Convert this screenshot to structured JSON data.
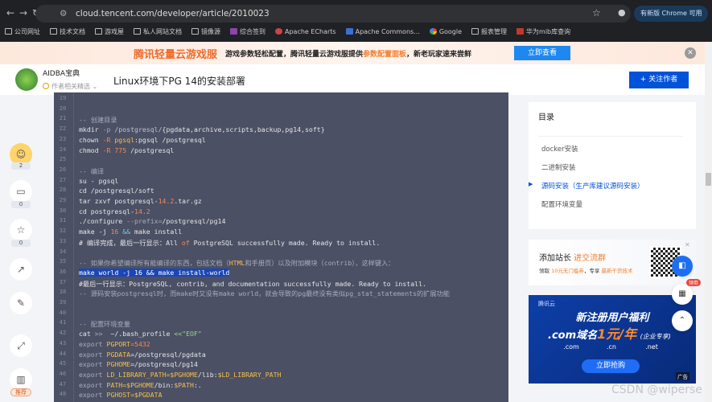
{
  "browser": {
    "url": "cloud.tencent.com/developer/article/2010023",
    "update_label": "有新版 Chrome 可用",
    "bookmarks": [
      {
        "label": "公司网址",
        "icon": "folder"
      },
      {
        "label": "技术文档",
        "icon": "folder"
      },
      {
        "label": "游戏屋",
        "icon": "folder"
      },
      {
        "label": "私人网站文档",
        "icon": "folder"
      },
      {
        "label": "镜像源",
        "icon": "folder"
      },
      {
        "label": "综合签到",
        "icon": "purple-square"
      },
      {
        "label": "Apache ECharts",
        "icon": "echarts"
      },
      {
        "label": "Apache Commons...",
        "icon": "blue-square"
      },
      {
        "label": "Google",
        "icon": "google"
      },
      {
        "label": "报表管理",
        "icon": "folder"
      },
      {
        "label": "华为mib库查询",
        "icon": "huawei"
      }
    ]
  },
  "banner": {
    "brand": "腾讯轻量云游戏服",
    "text_a": "游戏参数轻松配置，腾讯轻量云游戏服提供",
    "highlight": "参数配置面板",
    "text_b": "，新老玩家速来尝鲜",
    "button": "立即查看"
  },
  "header": {
    "author": "AIDBA宝典",
    "selection": "作者相关精选",
    "title": "Linux环境下PG 14的安装部署",
    "follow": "+ 关注作者"
  },
  "rail": {
    "like_count": "2",
    "comment_count": "0",
    "favorite_count": "0",
    "recommend_tag": "推荐"
  },
  "code": {
    "lines": [
      {
        "n": "19",
        "t": []
      },
      {
        "n": "20",
        "t": []
      },
      {
        "n": "21",
        "t": [
          [
            "-- 创建目录",
            "c"
          ]
        ]
      },
      {
        "n": "22",
        "t": [
          [
            "mkdir ",
            "p"
          ],
          [
            "-p",
            "c"
          ],
          [
            " /postgresql/",
            "d"
          ],
          [
            "{pgdata,archive,scripts,backup,pg14,soft}",
            "p"
          ]
        ]
      },
      {
        "n": "23",
        "t": [
          [
            "chown ",
            "p"
          ],
          [
            "-R ",
            "k"
          ],
          [
            "pgsql",
            "y"
          ],
          [
            ":pgsql /postgresql",
            "p"
          ]
        ]
      },
      {
        "n": "24",
        "t": [
          [
            "chmod ",
            "p"
          ],
          [
            "-R ",
            "k"
          ],
          [
            "775",
            "n"
          ],
          [
            " /postgresql",
            "p"
          ]
        ]
      },
      {
        "n": "25",
        "t": []
      },
      {
        "n": "26",
        "t": [
          [
            "-- 编译",
            "c"
          ]
        ]
      },
      {
        "n": "27",
        "t": [
          [
            "su - pgsql",
            "p"
          ]
        ]
      },
      {
        "n": "28",
        "t": [
          [
            "cd /postgresql/soft",
            "p"
          ]
        ]
      },
      {
        "n": "29",
        "t": [
          [
            "tar zxvf postgresql-",
            "p"
          ],
          [
            "14.2",
            "n"
          ],
          [
            ".tar.gz",
            "p"
          ]
        ]
      },
      {
        "n": "30",
        "t": [
          [
            "cd postgresql-",
            "p"
          ],
          [
            "14.2",
            "n"
          ]
        ]
      },
      {
        "n": "31",
        "t": [
          [
            "./configure ",
            "p"
          ],
          [
            "--prefix=",
            "c"
          ],
          [
            "/postgresql/pg14",
            "p"
          ]
        ]
      },
      {
        "n": "32",
        "t": [
          [
            "make -j ",
            "p"
          ],
          [
            "16",
            "n"
          ],
          [
            " && ",
            "b"
          ],
          [
            "make install",
            "p"
          ]
        ]
      },
      {
        "n": "33",
        "t": [
          [
            "# 编译完成，最后一行显示：All ",
            "p"
          ],
          [
            "of",
            "k"
          ],
          [
            " PostgreSQL successfully made. Ready to install.",
            "p"
          ]
        ]
      },
      {
        "n": "34",
        "t": []
      },
      {
        "n": "35",
        "t": [
          [
            "-- 如果你希望编译所有能编译的东西，包括文档（",
            "c"
          ],
          [
            "HTML",
            "y"
          ],
          [
            "和手册页）以及附加模块（contrib），这样键入：",
            "c"
          ]
        ]
      },
      {
        "n": "36",
        "t": [
          [
            "make world -j 16 && make install-world",
            "h"
          ]
        ]
      },
      {
        "n": "37",
        "t": [
          [
            "#最后一行显示：PostgreSQL, contrib, and documentation successfully made. Ready to install.",
            "p"
          ]
        ]
      },
      {
        "n": "38",
        "t": [
          [
            "-- 源码安装postgresql时，而make时又没有make world，就会导致的pg最终没有类似pg_stat_statements的扩展功能",
            "c"
          ]
        ]
      },
      {
        "n": "39",
        "t": []
      },
      {
        "n": "40",
        "t": []
      },
      {
        "n": "41",
        "t": [
          [
            "-- 配置环境变量",
            "c"
          ]
        ]
      },
      {
        "n": "42",
        "t": [
          [
            "cat ",
            "p"
          ],
          [
            ">>",
            "c"
          ],
          [
            "  ~/.bash_profile ",
            "p"
          ],
          [
            "<<\"EOF\"",
            "s"
          ]
        ]
      },
      {
        "n": "43",
        "t": [
          [
            "export ",
            "c"
          ],
          [
            "PGPORT",
            "y"
          ],
          [
            "=5432",
            "n"
          ]
        ]
      },
      {
        "n": "44",
        "t": [
          [
            "export ",
            "c"
          ],
          [
            "PGDATA",
            "y"
          ],
          [
            "=/postgresql/pgdata",
            "p"
          ]
        ]
      },
      {
        "n": "45",
        "t": [
          [
            "export ",
            "c"
          ],
          [
            "PGHOME",
            "y"
          ],
          [
            "=/postgresql/pg14",
            "p"
          ]
        ]
      },
      {
        "n": "46",
        "t": [
          [
            "export ",
            "c"
          ],
          [
            "LD_LIBRARY_PATH",
            "y"
          ],
          [
            "=$PGHOME",
            "y"
          ],
          [
            "/lib:",
            "p"
          ],
          [
            "$LD_LIBRARY_PATH",
            "y"
          ]
        ]
      },
      {
        "n": "47",
        "t": [
          [
            "export ",
            "c"
          ],
          [
            "PATH",
            "y"
          ],
          [
            "=$PGHOME",
            "y"
          ],
          [
            "/bin:",
            "p"
          ],
          [
            "$PATH",
            "y"
          ],
          [
            ":.",
            "p"
          ]
        ]
      },
      {
        "n": "48",
        "t": [
          [
            "export ",
            "c"
          ],
          [
            "PGHOST",
            "y"
          ],
          [
            "=$PGDATA",
            "y"
          ]
        ]
      }
    ]
  },
  "toc": {
    "title": "目录",
    "items": [
      {
        "label": "docker安装",
        "active": false
      },
      {
        "label": "二进制安装",
        "active": false
      },
      {
        "label": "源码安装（生产库建议源码安装）",
        "active": true
      },
      {
        "label": "配置环境变量",
        "active": false
      }
    ]
  },
  "ad1": {
    "title": "添加站长",
    "title_hl": "进交流群",
    "sub_a": "领取",
    "sub_hl1": "10元无门槛券",
    "sub_b": "，专享",
    "sub_hl2": "最新干货技术"
  },
  "ad2": {
    "brand": "腾讯云",
    "headline": "新注册用户福利",
    "line2_a": ".com域名",
    "line2_price": "1元/年",
    "line2_note": "(企业专享)",
    "domains": [
      ".com",
      ".cn",
      ".net"
    ],
    "button": "立即抢购",
    "ad_label": "广告"
  },
  "float": {
    "hot_badge": "领劵"
  },
  "watermark": "CSDN @wiperse",
  "colors": {
    "accent": "#0052d9",
    "banner_orange": "#ef6a2a",
    "code_bg": "#4b5064"
  }
}
